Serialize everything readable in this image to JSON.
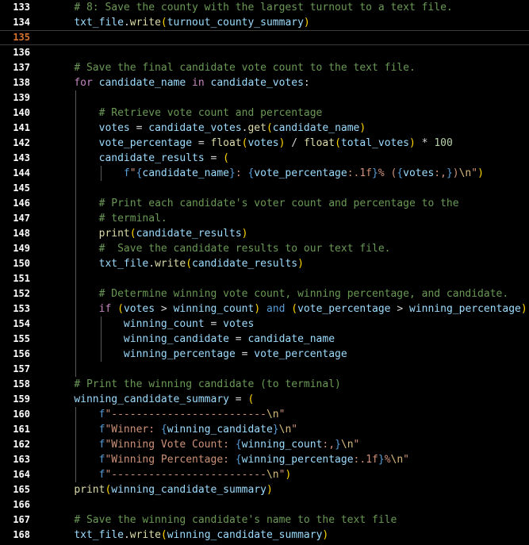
{
  "theme": {
    "background": "#000000",
    "line_number": "#ffffff",
    "current_line_number": "#d7732e",
    "keyword": "#c586c0",
    "keyword_blue": "#569cd6",
    "function": "#dcdcaa",
    "variable": "#9cdcfe",
    "string": "#ce9178",
    "number": "#b5cea8",
    "comment": "#6a9955",
    "bracket": "#ffd700"
  },
  "current_line": 135,
  "lines": [
    {
      "n": "133",
      "tokens": [
        [
          "    ",
          "pln"
        ],
        [
          "# 8: Save the county with the largest turnout to a text file.",
          "cmt"
        ]
      ]
    },
    {
      "n": "134",
      "tokens": [
        [
          "    ",
          "pln"
        ],
        [
          "txt_file",
          "var"
        ],
        [
          ".",
          "op"
        ],
        [
          "write",
          "fn"
        ],
        [
          "(",
          "pun"
        ],
        [
          "turnout_county_summary",
          "var"
        ],
        [
          ")",
          "pun"
        ]
      ]
    },
    {
      "n": "135",
      "tokens": []
    },
    {
      "n": "136",
      "tokens": []
    },
    {
      "n": "137",
      "tokens": [
        [
          "    ",
          "pln"
        ],
        [
          "# Save the final candidate vote count to the text file.",
          "cmt"
        ]
      ]
    },
    {
      "n": "138",
      "tokens": [
        [
          "    ",
          "pln"
        ],
        [
          "for",
          "kw"
        ],
        [
          " ",
          "pln"
        ],
        [
          "candidate_name",
          "var"
        ],
        [
          " ",
          "pln"
        ],
        [
          "in",
          "kw"
        ],
        [
          " ",
          "pln"
        ],
        [
          "candidate_votes",
          "var"
        ],
        [
          ":",
          "op"
        ]
      ]
    },
    {
      "n": "139",
      "tokens": []
    },
    {
      "n": "140",
      "tokens": [
        [
          "        ",
          "pln"
        ],
        [
          "# Retrieve vote count and percentage",
          "cmt"
        ]
      ]
    },
    {
      "n": "141",
      "tokens": [
        [
          "        ",
          "pln"
        ],
        [
          "votes",
          "var"
        ],
        [
          " = ",
          "op"
        ],
        [
          "candidate_votes",
          "var"
        ],
        [
          ".",
          "op"
        ],
        [
          "get",
          "fn"
        ],
        [
          "(",
          "pun"
        ],
        [
          "candidate_name",
          "var"
        ],
        [
          ")",
          "pun"
        ]
      ]
    },
    {
      "n": "142",
      "tokens": [
        [
          "        ",
          "pln"
        ],
        [
          "vote_percentage",
          "var"
        ],
        [
          " = ",
          "op"
        ],
        [
          "float",
          "fn"
        ],
        [
          "(",
          "pun"
        ],
        [
          "votes",
          "var"
        ],
        [
          ")",
          "pun"
        ],
        [
          " / ",
          "op"
        ],
        [
          "float",
          "fn"
        ],
        [
          "(",
          "pun"
        ],
        [
          "total_votes",
          "var"
        ],
        [
          ")",
          "pun"
        ],
        [
          " * ",
          "op"
        ],
        [
          "100",
          "num"
        ]
      ]
    },
    {
      "n": "143",
      "tokens": [
        [
          "        ",
          "pln"
        ],
        [
          "candidate_results",
          "var"
        ],
        [
          " = ",
          "op"
        ],
        [
          "(",
          "pun"
        ]
      ]
    },
    {
      "n": "144",
      "tokens": [
        [
          "            ",
          "pln"
        ],
        [
          "f",
          "kwb"
        ],
        [
          "\"",
          "str"
        ],
        [
          "{",
          "fmt"
        ],
        [
          "candidate_name",
          "var"
        ],
        [
          "}",
          "fmt"
        ],
        [
          ": ",
          "str"
        ],
        [
          "{",
          "fmt"
        ],
        [
          "vote_percentage",
          "var"
        ],
        [
          ":.1f",
          "str"
        ],
        [
          "}",
          "fmt"
        ],
        [
          "% (",
          "str"
        ],
        [
          "{",
          "fmt"
        ],
        [
          "votes",
          "var"
        ],
        [
          ":,",
          "str"
        ],
        [
          "}",
          "fmt"
        ],
        [
          ")",
          "str"
        ],
        [
          "\\n",
          "esc"
        ],
        [
          "\"",
          "str"
        ],
        [
          ")",
          "pun"
        ]
      ]
    },
    {
      "n": "145",
      "tokens": []
    },
    {
      "n": "146",
      "tokens": [
        [
          "        ",
          "pln"
        ],
        [
          "# Print each candidate's voter count and percentage to the",
          "cmt"
        ]
      ]
    },
    {
      "n": "147",
      "tokens": [
        [
          "        ",
          "pln"
        ],
        [
          "# terminal.",
          "cmt"
        ]
      ]
    },
    {
      "n": "148",
      "tokens": [
        [
          "        ",
          "pln"
        ],
        [
          "print",
          "fn"
        ],
        [
          "(",
          "pun"
        ],
        [
          "candidate_results",
          "var"
        ],
        [
          ")",
          "pun"
        ]
      ]
    },
    {
      "n": "149",
      "tokens": [
        [
          "        ",
          "pln"
        ],
        [
          "#  Save the candidate results to our text file.",
          "cmt"
        ]
      ]
    },
    {
      "n": "150",
      "tokens": [
        [
          "        ",
          "pln"
        ],
        [
          "txt_file",
          "var"
        ],
        [
          ".",
          "op"
        ],
        [
          "write",
          "fn"
        ],
        [
          "(",
          "pun"
        ],
        [
          "candidate_results",
          "var"
        ],
        [
          ")",
          "pun"
        ]
      ]
    },
    {
      "n": "151",
      "tokens": []
    },
    {
      "n": "152",
      "tokens": [
        [
          "        ",
          "pln"
        ],
        [
          "# Determine winning vote count, winning percentage, and candidate.",
          "cmt"
        ]
      ]
    },
    {
      "n": "153",
      "tokens": [
        [
          "        ",
          "pln"
        ],
        [
          "if",
          "kw"
        ],
        [
          " ",
          "pln"
        ],
        [
          "(",
          "pun"
        ],
        [
          "votes",
          "var"
        ],
        [
          " > ",
          "op"
        ],
        [
          "winning_count",
          "var"
        ],
        [
          ")",
          "pun"
        ],
        [
          " ",
          "pln"
        ],
        [
          "and",
          "kwb"
        ],
        [
          " ",
          "pln"
        ],
        [
          "(",
          "pun"
        ],
        [
          "vote_percentage",
          "var"
        ],
        [
          " > ",
          "op"
        ],
        [
          "winning_percentage",
          "var"
        ],
        [
          ")",
          "pun"
        ],
        [
          ":",
          "op"
        ]
      ]
    },
    {
      "n": "154",
      "tokens": [
        [
          "            ",
          "pln"
        ],
        [
          "winning_count",
          "var"
        ],
        [
          " = ",
          "op"
        ],
        [
          "votes",
          "var"
        ]
      ]
    },
    {
      "n": "155",
      "tokens": [
        [
          "            ",
          "pln"
        ],
        [
          "winning_candidate",
          "var"
        ],
        [
          " = ",
          "op"
        ],
        [
          "candidate_name",
          "var"
        ]
      ]
    },
    {
      "n": "156",
      "tokens": [
        [
          "            ",
          "pln"
        ],
        [
          "winning_percentage",
          "var"
        ],
        [
          " = ",
          "op"
        ],
        [
          "vote_percentage",
          "var"
        ]
      ]
    },
    {
      "n": "157",
      "tokens": []
    },
    {
      "n": "158",
      "tokens": [
        [
          "    ",
          "pln"
        ],
        [
          "# Print the winning candidate (to terminal)",
          "cmt"
        ]
      ]
    },
    {
      "n": "159",
      "tokens": [
        [
          "    ",
          "pln"
        ],
        [
          "winning_candidate_summary",
          "var"
        ],
        [
          " = ",
          "op"
        ],
        [
          "(",
          "pun"
        ]
      ]
    },
    {
      "n": "160",
      "tokens": [
        [
          "        ",
          "pln"
        ],
        [
          "f",
          "kwb"
        ],
        [
          "\"-------------------------",
          "str"
        ],
        [
          "\\n",
          "esc"
        ],
        [
          "\"",
          "str"
        ]
      ]
    },
    {
      "n": "161",
      "tokens": [
        [
          "        ",
          "pln"
        ],
        [
          "f",
          "kwb"
        ],
        [
          "\"Winner: ",
          "str"
        ],
        [
          "{",
          "fmt"
        ],
        [
          "winning_candidate",
          "var"
        ],
        [
          "}",
          "fmt"
        ],
        [
          "\\n",
          "esc"
        ],
        [
          "\"",
          "str"
        ]
      ]
    },
    {
      "n": "162",
      "tokens": [
        [
          "        ",
          "pln"
        ],
        [
          "f",
          "kwb"
        ],
        [
          "\"Winning Vote Count: ",
          "str"
        ],
        [
          "{",
          "fmt"
        ],
        [
          "winning_count",
          "var"
        ],
        [
          ":,",
          "str"
        ],
        [
          "}",
          "fmt"
        ],
        [
          "\\n",
          "esc"
        ],
        [
          "\"",
          "str"
        ]
      ]
    },
    {
      "n": "163",
      "tokens": [
        [
          "        ",
          "pln"
        ],
        [
          "f",
          "kwb"
        ],
        [
          "\"Winning Percentage: ",
          "str"
        ],
        [
          "{",
          "fmt"
        ],
        [
          "winning_percentage",
          "var"
        ],
        [
          ":.1f",
          "str"
        ],
        [
          "}",
          "fmt"
        ],
        [
          "%",
          "str"
        ],
        [
          "\\n",
          "esc"
        ],
        [
          "\"",
          "str"
        ]
      ]
    },
    {
      "n": "164",
      "tokens": [
        [
          "        ",
          "pln"
        ],
        [
          "f",
          "kwb"
        ],
        [
          "\"-------------------------",
          "str"
        ],
        [
          "\\n",
          "esc"
        ],
        [
          "\"",
          "str"
        ],
        [
          ")",
          "pun"
        ]
      ]
    },
    {
      "n": "165",
      "tokens": [
        [
          "    ",
          "pln"
        ],
        [
          "print",
          "fn"
        ],
        [
          "(",
          "pun"
        ],
        [
          "winning_candidate_summary",
          "var"
        ],
        [
          ")",
          "pun"
        ]
      ]
    },
    {
      "n": "166",
      "tokens": []
    },
    {
      "n": "167",
      "tokens": [
        [
          "    ",
          "pln"
        ],
        [
          "# Save the winning candidate's name to the text file",
          "cmt"
        ]
      ]
    },
    {
      "n": "168",
      "tokens": [
        [
          "    ",
          "pln"
        ],
        [
          "txt_file",
          "var"
        ],
        [
          ".",
          "op"
        ],
        [
          "write",
          "fn"
        ],
        [
          "(",
          "pun"
        ],
        [
          "winning_candidate_summary",
          "var"
        ],
        [
          ")",
          "pun"
        ]
      ]
    }
  ]
}
